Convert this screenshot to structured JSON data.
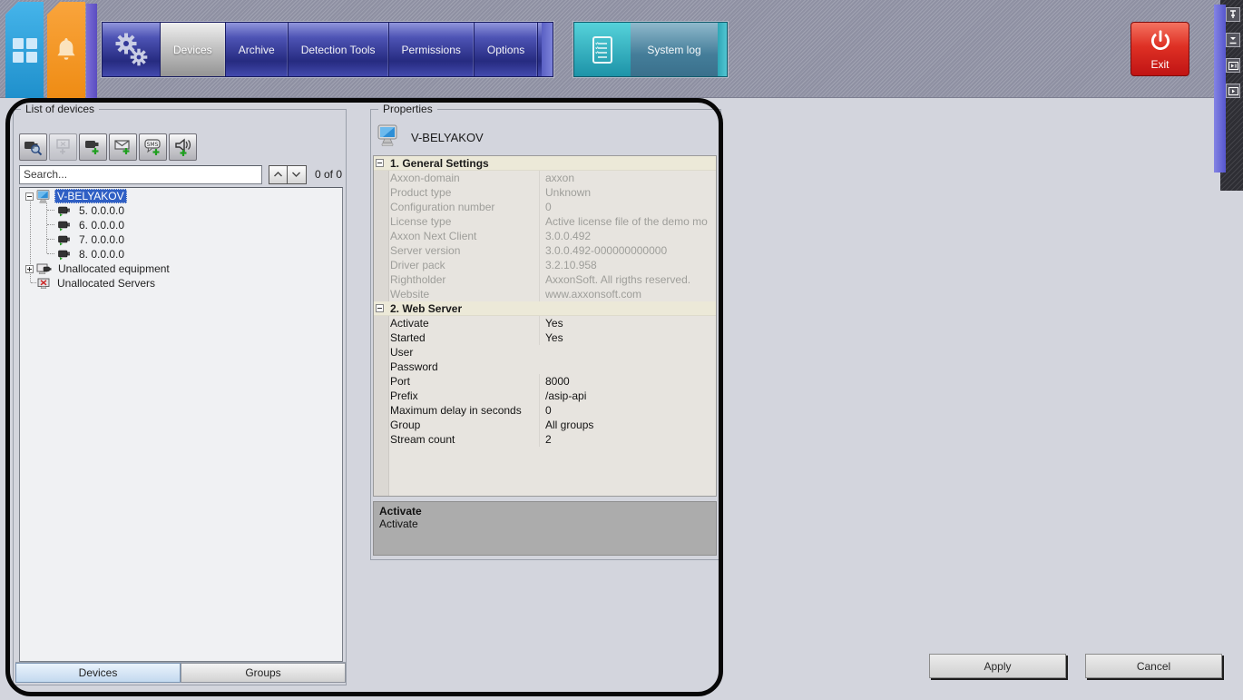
{
  "top_bar": {
    "nav_tabs": [
      {
        "label": "Devices",
        "active": true
      },
      {
        "label": "Archive",
        "active": false
      },
      {
        "label": "Detection Tools",
        "active": false
      },
      {
        "label": "Permissions",
        "active": false
      },
      {
        "label": "Options",
        "active": false
      }
    ],
    "system_log_label": "System log",
    "exit_label": "Exit",
    "icons": [
      "layout-grid-icon",
      "alarm-bell-icon",
      "settings-gears-icon",
      "system-log-icon",
      "power-icon",
      "pin-icon",
      "collapse-icon",
      "panel-detach-icon",
      "panel-play-icon"
    ]
  },
  "devices_panel": {
    "title": "List of devices",
    "toolbar_icons": [
      "device-discovery-icon",
      "add-group-disabled-icon",
      "add-camera-icon",
      "add-email-icon",
      "add-sms-icon",
      "add-speaker-icon"
    ],
    "search": {
      "placeholder": "Search...",
      "count_label": "0 of 0"
    },
    "tree": [
      {
        "label": "V-BELYAKOV",
        "icon": "monitor",
        "expander": "minus",
        "level": 0,
        "selected": true
      },
      {
        "label": "5. 0.0.0.0",
        "icon": "camera",
        "level": 1
      },
      {
        "label": "6. 0.0.0.0",
        "icon": "camera",
        "level": 1
      },
      {
        "label": "7. 0.0.0.0",
        "icon": "camera",
        "level": 1
      },
      {
        "label": "8. 0.0.0.0",
        "icon": "camera",
        "level": 1
      },
      {
        "label": "Unallocated equipment",
        "icon": "monitor-camera",
        "expander": "plus",
        "level": 0
      },
      {
        "label": "Unallocated Servers",
        "icon": "monitor-x",
        "level": 0
      }
    ],
    "bottom_tabs": [
      {
        "label": "Devices",
        "active": true
      },
      {
        "label": "Groups",
        "active": false
      }
    ]
  },
  "properties_panel": {
    "title": "Properties",
    "device_name": "V-BELYAKOV",
    "sections": [
      {
        "header": "1. General Settings",
        "readonly": true,
        "rows": [
          {
            "name": "Axxon-domain",
            "value": "axxon"
          },
          {
            "name": "Product type",
            "value": "Unknown"
          },
          {
            "name": "Configuration number",
            "value": "0"
          },
          {
            "name": "License type",
            "value": "Active license file of the demo mo"
          },
          {
            "name": "Axxon Next Client",
            "value": "3.0.0.492"
          },
          {
            "name": "Server version",
            "value": "3.0.0.492-000000000000"
          },
          {
            "name": "Driver pack",
            "value": "3.2.10.958"
          },
          {
            "name": "Rightholder",
            "value": "AxxonSoft. All rigths reserved."
          },
          {
            "name": "Website",
            "value": "www.axxonsoft.com"
          }
        ]
      },
      {
        "header": "2. Web Server",
        "readonly": false,
        "rows": [
          {
            "name": "Activate",
            "value": "Yes"
          },
          {
            "name": "Started",
            "value": "Yes"
          },
          {
            "name": "User",
            "value": ""
          },
          {
            "name": "Password",
            "value": ""
          },
          {
            "name": "Port",
            "value": "8000"
          },
          {
            "name": "Prefix",
            "value": "/asip-api"
          },
          {
            "name": "Maximum delay in seconds",
            "value": "0"
          },
          {
            "name": "Group",
            "value": "All groups"
          },
          {
            "name": "Stream count",
            "value": "2"
          }
        ]
      }
    ],
    "description": {
      "title": "Activate",
      "text": "Activate"
    }
  },
  "footer": {
    "apply_label": "Apply",
    "cancel_label": "Cancel"
  },
  "colors": {
    "selection_blue": "#2f5fc4",
    "toolbar_blue": "#262b80",
    "exit_red": "#c01414",
    "teal": "#1d93a8",
    "category_bg": "#ece9d8"
  }
}
